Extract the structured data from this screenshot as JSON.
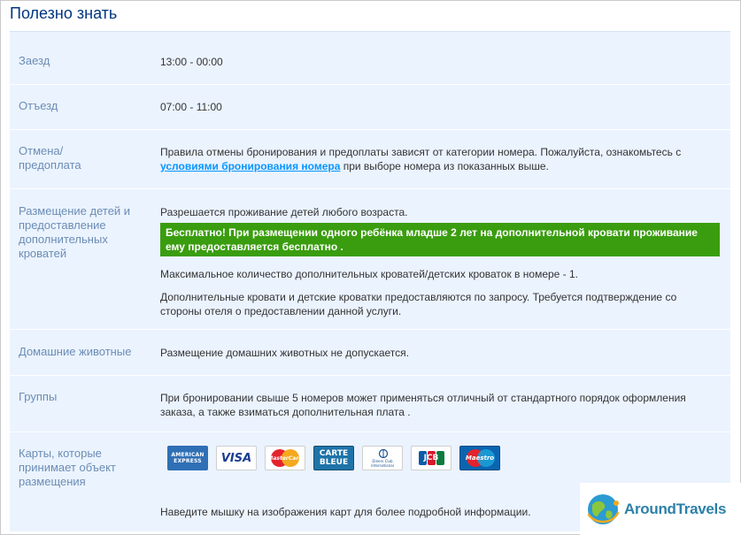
{
  "section_title": "Полезно знать",
  "rows": {
    "checkin": {
      "label": "Заезд",
      "value": "13:00 - 00:00"
    },
    "checkout": {
      "label": "Отъезд",
      "value": "07:00 - 11:00"
    },
    "cancellation": {
      "label": "Отмена/ предоплата",
      "text_before": "Правила отмены бронирования и предоплаты зависят от категории номера. Пожалуйста, ознакомьтесь с ",
      "link": "условиями бронирования номера",
      "text_after": " при выборе номера из показанных выше."
    },
    "children": {
      "label": "Размещение детей и предоставление дополнительных кроватей",
      "line1": "Разрешается проживание детей любого возраста.",
      "banner_strong": "Бесплатно!",
      "banner_text": " При размещении одного ребёнка младше 2 лет на дополнительной кровати проживание ему предоставляется бесплатно .",
      "line2": "Максимальное количество дополнительных кроватей/детских кроваток в номере - 1.",
      "line3": "Дополнительные кровати и детские кроватки предоставляются по запросу. Требуется подтверждение со стороны отеля о предоставлении данной услуги."
    },
    "pets": {
      "label": "Домашние животные",
      "value": "Размещение домашних животных не допускается."
    },
    "groups": {
      "label": "Группы",
      "value": "При бронировании свыше 5 номеров может применяться отличный от стандартного порядок оформления заказа, а также взиматься дополнительная плата ."
    },
    "cards": {
      "label": "Карты, которые принимает объект размещения",
      "hint": "Наведите мышку на изображения карт для более подробной информации.",
      "items": [
        {
          "name": "american-express",
          "line1": "AMERICAN",
          "line2": "EXPRESS",
          "color": "#2f6fb5"
        },
        {
          "name": "visa",
          "line1": "VISA",
          "color": "#1a3d8f"
        },
        {
          "name": "mastercard",
          "line1": "MasterCard",
          "color": "#e4232d"
        },
        {
          "name": "carte-bleue",
          "line1": "CARTE",
          "line2": "BLEUE",
          "color": "#1e73a8"
        },
        {
          "name": "diners-club",
          "line1": "Diners Club",
          "line2": "International",
          "color": "#1c4f8c"
        },
        {
          "name": "jcb",
          "line1": "JCB",
          "color": "#0e7a3e"
        },
        {
          "name": "maestro",
          "line1": "Maestro",
          "color": "#0a65b0"
        }
      ]
    }
  },
  "watermark": {
    "text": "AroundTravels"
  }
}
